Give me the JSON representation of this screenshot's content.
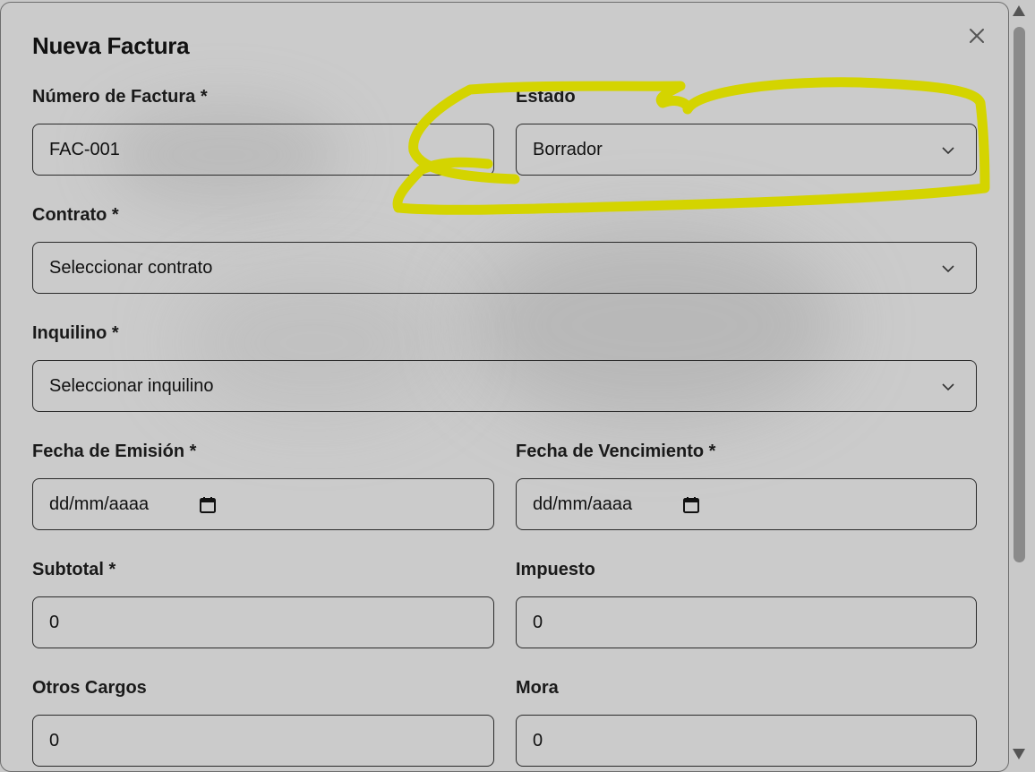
{
  "dialog": {
    "title": "Nueva Factura",
    "close_icon": "close-icon"
  },
  "form": {
    "invoice_number": {
      "label": "Número de Factura *",
      "value": "FAC-001"
    },
    "status": {
      "label": "Estado",
      "value": "Borrador"
    },
    "contract": {
      "label": "Contrato *",
      "value": "Seleccionar contrato"
    },
    "tenant": {
      "label": "Inquilino *",
      "value": "Seleccionar inquilino"
    },
    "issue_date": {
      "label": "Fecha de Emisión *",
      "placeholder": "dd/mm/aaaa"
    },
    "due_date": {
      "label": "Fecha de Vencimiento *",
      "placeholder": "dd/mm/aaaa"
    },
    "subtotal": {
      "label": "Subtotal *",
      "value": "0"
    },
    "tax": {
      "label": "Impuesto",
      "value": "0"
    },
    "other_charges": {
      "label": "Otros Cargos",
      "value": "0"
    },
    "late_fee": {
      "label": "Mora",
      "value": "0"
    }
  },
  "annotation": {
    "color": "#d4d400",
    "kind": "hand-drawn highlight around Estado field"
  }
}
